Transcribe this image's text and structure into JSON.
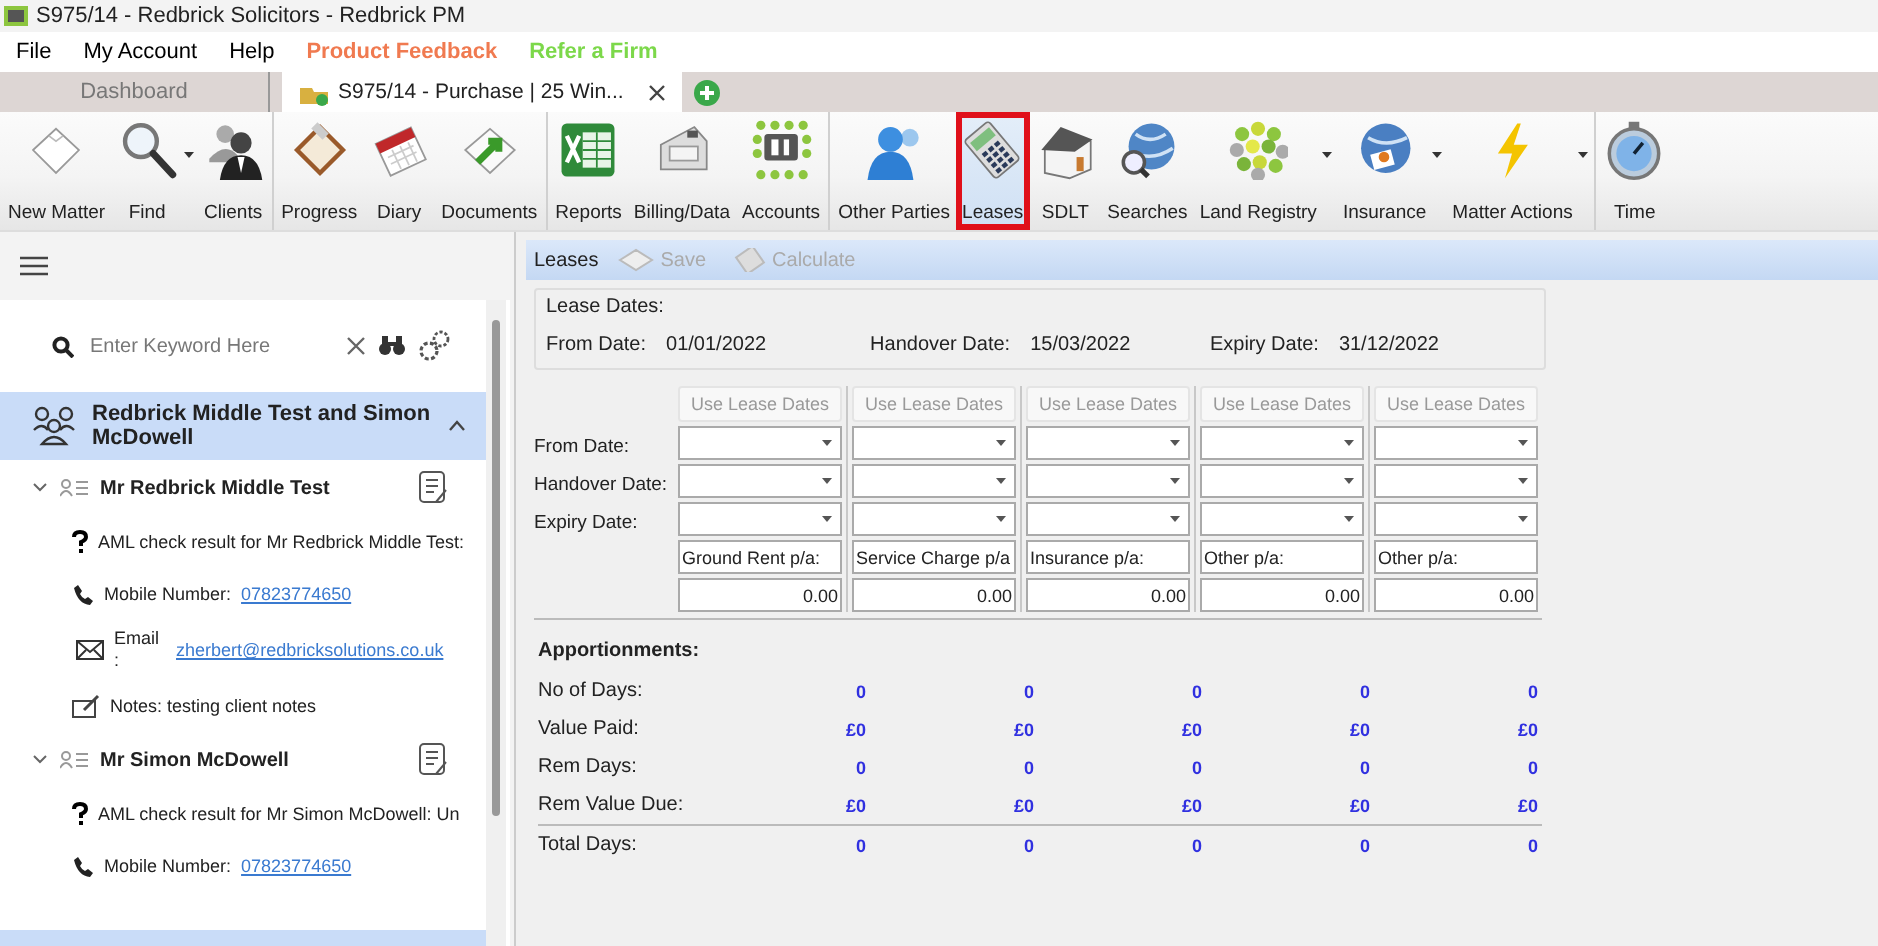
{
  "window": {
    "title": "S975/14 - Redbrick Solicitors - Redbrick PM"
  },
  "menu": [
    {
      "label": "File",
      "kind": "plain"
    },
    {
      "label": "My Account",
      "kind": "plain"
    },
    {
      "label": "Help",
      "kind": "plain"
    },
    {
      "label": "Product Feedback",
      "kind": "feedback"
    },
    {
      "label": "Refer a Firm",
      "kind": "refer"
    }
  ],
  "tabs": [
    {
      "label": "Dashboard",
      "selected": false
    },
    {
      "label": "S975/14 - Purchase | 25 Win...",
      "selected": true
    }
  ],
  "toolbar": [
    [
      {
        "label": "New Matter",
        "dropdown": false,
        "selected": false
      },
      {
        "label": "Find",
        "dropdown": true,
        "selected": false
      },
      {
        "label": "Clients",
        "dropdown": false,
        "selected": false
      }
    ],
    [
      {
        "label": "Progress",
        "dropdown": false,
        "selected": false
      },
      {
        "label": "Diary",
        "dropdown": false,
        "selected": false
      },
      {
        "label": "Documents",
        "dropdown": false,
        "selected": false
      }
    ],
    [
      {
        "label": "Reports",
        "dropdown": false,
        "selected": false
      },
      {
        "label": "Billing/Data",
        "dropdown": false,
        "selected": false
      },
      {
        "label": "Accounts",
        "dropdown": false,
        "selected": false
      }
    ],
    [
      {
        "label": "Other Parties",
        "dropdown": false,
        "selected": false
      },
      {
        "label": "Leases",
        "dropdown": false,
        "selected": true
      },
      {
        "label": "SDLT",
        "dropdown": false,
        "selected": false
      },
      {
        "label": "Searches",
        "dropdown": false,
        "selected": false
      },
      {
        "label": "Land Registry",
        "dropdown": true,
        "selected": false
      },
      {
        "label": "Insurance",
        "dropdown": true,
        "selected": false
      },
      {
        "label": "Matter Actions",
        "dropdown": true,
        "selected": false
      }
    ],
    [
      {
        "label": "Time",
        "dropdown": false,
        "selected": false
      }
    ]
  ],
  "sidebar": {
    "search": {
      "placeholder": "Enter Keyword Here"
    },
    "group": {
      "title": "Redbrick Middle Test and Simon McDowell",
      "expanded": true
    },
    "contacts": [
      {
        "name": "Mr Redbrick Middle Test",
        "expanded": true,
        "details": [
          {
            "kind": "aml",
            "text": "AML check result for Mr Redbrick Middle Test:"
          },
          {
            "kind": "phone",
            "label": "Mobile Number:",
            "value": "07823774650"
          },
          {
            "kind": "email",
            "label": "Email :",
            "value": "zherbert@redbricksolutions.co.uk"
          },
          {
            "kind": "notes",
            "text": "Notes: testing client notes"
          }
        ]
      },
      {
        "name": "Mr Simon McDowell",
        "expanded": true,
        "details": [
          {
            "kind": "aml",
            "text": "AML check result for Mr Simon McDowell: Un"
          },
          {
            "kind": "phone",
            "label": "Mobile Number:",
            "value": "07823774650"
          }
        ]
      }
    ]
  },
  "leases": {
    "title": "Leases",
    "actions": [
      {
        "label": "Save",
        "disabled": true
      },
      {
        "label": "Calculate",
        "disabled": true
      }
    ],
    "lease_dates": {
      "title": "Lease Dates:",
      "items": [
        {
          "label": "From Date:",
          "value": "01/01/2022"
        },
        {
          "label": "Handover Date:",
          "value": "15/03/2022"
        },
        {
          "label": "Expiry Date:",
          "value": "31/12/2022"
        }
      ]
    },
    "row_labels": [
      "From Date:",
      "Handover Date:",
      "Expiry Date:"
    ],
    "columns": [
      {
        "button": "Use Lease Dates",
        "button_disabled": true,
        "description": "Ground Rent p/a:",
        "amount": "0.00"
      },
      {
        "button": "Use Lease Dates",
        "button_disabled": true,
        "description": "Service Charge p/a",
        "amount": "0.00"
      },
      {
        "button": "Use Lease Dates",
        "button_disabled": true,
        "description": "Insurance p/a:",
        "amount": "0.00"
      },
      {
        "button": "Use Lease Dates",
        "button_disabled": true,
        "description": "Other p/a:",
        "amount": "0.00"
      },
      {
        "button": "Use Lease Dates",
        "button_disabled": true,
        "description": "Other p/a:",
        "amount": "0.00"
      }
    ],
    "apportionments": {
      "title": "Apportionments:",
      "rows": [
        {
          "kind": "plain",
          "label": "No of Days:",
          "values": [
            "0",
            "0",
            "0",
            "0",
            "0"
          ]
        },
        {
          "kind": "plain",
          "label": "Value Paid:",
          "values": [
            "£0",
            "£0",
            "£0",
            "£0",
            "£0"
          ]
        },
        {
          "kind": "plain",
          "label": "Rem Days:",
          "values": [
            "0",
            "0",
            "0",
            "0",
            "0"
          ]
        },
        {
          "kind": "plain",
          "label": "Rem Value Due:",
          "values": [
            "£0",
            "£0",
            "£0",
            "£0",
            "£0"
          ]
        },
        {
          "kind": "total",
          "label": "Total Days:",
          "values": [
            "0",
            "0",
            "0",
            "0",
            "0"
          ]
        }
      ]
    }
  }
}
